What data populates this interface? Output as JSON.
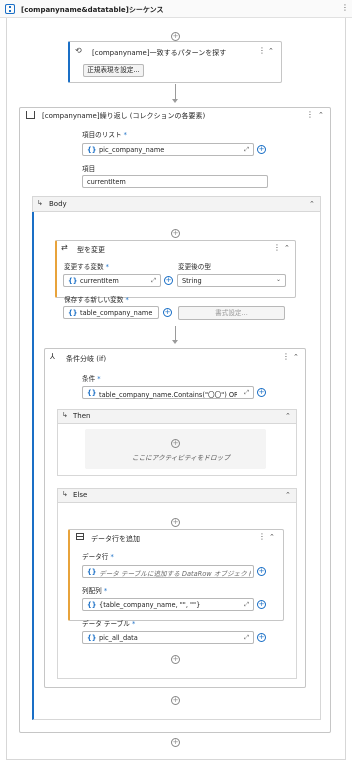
{
  "sequence": {
    "title": "[companyname&datatable]シーケンス"
  },
  "find_matching": {
    "title": "[companyname]一致するパターンを探す",
    "button_label": "正規表現を設定..."
  },
  "foreach": {
    "title": "[companyname]繰り返し (コレクションの各要素)",
    "list_label": "項目のリスト",
    "list_value": "pic_company_name",
    "item_label": "項目",
    "item_value": "currentItem",
    "body_label": "Body"
  },
  "convert": {
    "title": "型を変更",
    "var_label": "変更する変数",
    "var_value": "currentItem",
    "type_label": "変更後の型",
    "type_value": "String",
    "save_label": "保存する新しい変数",
    "save_value": "table_company_name",
    "format_button": "書式設定..."
  },
  "if_block": {
    "title": "条件分岐 (if)",
    "condition_label": "条件",
    "condition_value": "table_company_name.Contains(\"〇〇\") OR",
    "then_label": "Then",
    "drop_hint": "ここにアクティビティをドロップ",
    "else_label": "Else"
  },
  "add_row": {
    "title": "データ行を追加",
    "row_label": "データ行",
    "row_placeholder": "データ テーブルに追加する DataRow オブジェクト",
    "array_label": "列配列",
    "array_value": "{table_company_name, \"\", \"\"}",
    "table_label": "データ テーブル",
    "table_value": "pic_all_data"
  },
  "required_mark": "*",
  "icons": [
    "sequence-icon",
    "find-pattern-icon",
    "foreach-icon",
    "convert-type-icon",
    "if-icon",
    "add-row-icon",
    "expression-icon",
    "add-circle-icon",
    "kebab-menu-icon",
    "collapse-icon"
  ]
}
